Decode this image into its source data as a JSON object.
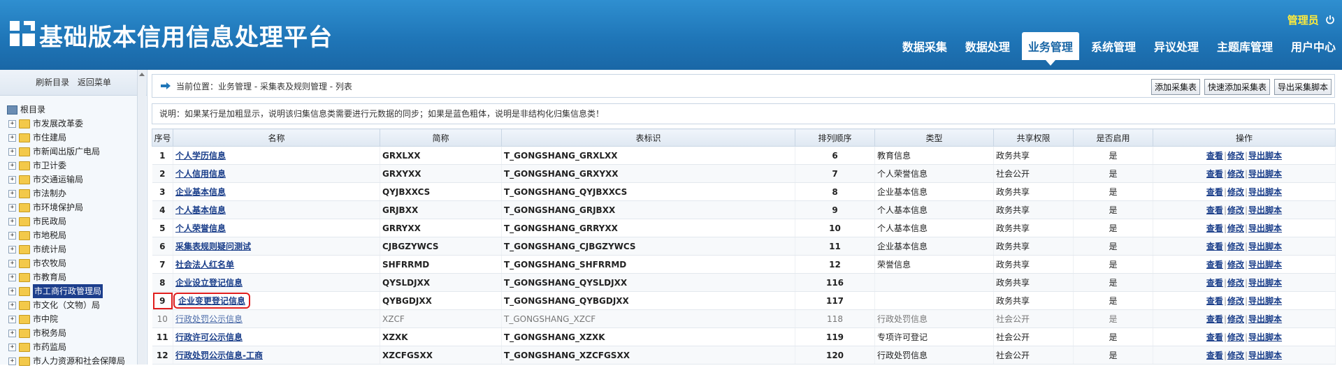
{
  "header": {
    "title": "基础版本信用信息处理平台",
    "user": "管理员",
    "nav": [
      "数据采集",
      "数据处理",
      "业务管理",
      "系统管理",
      "异议处理",
      "主题库管理",
      "用户中心"
    ],
    "active_nav": "业务管理"
  },
  "sidebar": {
    "refresh": "刷新目录",
    "back": "返回菜单",
    "root": "根目录",
    "items": [
      "市发展改革委",
      "市住建局",
      "市新闻出版广电局",
      "市卫计委",
      "市交通运输局",
      "市法制办",
      "市环境保护局",
      "市民政局",
      "市地税局",
      "市统计局",
      "市农牧局",
      "市教育局",
      "市工商行政管理局",
      "市文化（文物）局",
      "市中院",
      "市税务局",
      "市药监局",
      "市人力资源和社会保障局"
    ],
    "selected": "市工商行政管理局"
  },
  "location": {
    "label": "当前位置：",
    "path": "业务管理 - 采集表及规则管理 - 列表"
  },
  "buttons": [
    "添加采集表",
    "快速添加采集表",
    "导出采集脚本"
  ],
  "note": "说明：如果某行是加粗显示，说明该归集信息类需要进行元数据的同步；如果是蓝色粗体，说明是非结构化归集信息类！",
  "table": {
    "headers": [
      "序号",
      "名称",
      "简称",
      "表标识",
      "排列顺序",
      "类型",
      "共享权限",
      "是否启用",
      "操作"
    ],
    "ops": [
      "查看",
      "修改",
      "导出脚本"
    ],
    "rows": [
      {
        "no": "1",
        "name": "个人学历信息",
        "short": "GRXLXX",
        "table": "T_GONGSHANG_GRXLXX",
        "order": "6",
        "type": "教育信息",
        "share": "政务共享",
        "enabled": "是",
        "bold": true
      },
      {
        "no": "2",
        "name": "个人信用信息",
        "short": "GRXYXX",
        "table": "T_GONGSHANG_GRXYXX",
        "order": "7",
        "type": "个人荣誉信息",
        "share": "社会公开",
        "enabled": "是",
        "bold": true
      },
      {
        "no": "3",
        "name": "企业基本信息",
        "short": "QYJBXXCS",
        "table": "T_GONGSHANG_QYJBXXCS",
        "order": "8",
        "type": "企业基本信息",
        "share": "政务共享",
        "enabled": "是",
        "bold": true
      },
      {
        "no": "4",
        "name": "个人基本信息",
        "short": "GRJBXX",
        "table": "T_GONGSHANG_GRJBXX",
        "order": "9",
        "type": "个人基本信息",
        "share": "政务共享",
        "enabled": "是",
        "bold": true
      },
      {
        "no": "5",
        "name": "个人荣誉信息",
        "short": "GRRYXX",
        "table": "T_GONGSHANG_GRRYXX",
        "order": "10",
        "type": "个人基本信息",
        "share": "政务共享",
        "enabled": "是",
        "bold": true
      },
      {
        "no": "6",
        "name": "采集表规则疑问测试",
        "short": "CJBGZYWCS",
        "table": "T_GONGSHANG_CJBGZYWCS",
        "order": "11",
        "type": "企业基本信息",
        "share": "政务共享",
        "enabled": "是",
        "bold": true
      },
      {
        "no": "7",
        "name": "社会法人红名单",
        "short": "SHFRRMD",
        "table": "T_GONGSHANG_SHFRRMD",
        "order": "12",
        "type": "荣誉信息",
        "share": "政务共享",
        "enabled": "是",
        "bold": true
      },
      {
        "no": "8",
        "name": "企业设立登记信息",
        "short": "QYSLDJXX",
        "table": "T_GONGSHANG_QYSLDJXX",
        "order": "116",
        "type": "",
        "share": "政务共享",
        "enabled": "是",
        "bold": true
      },
      {
        "no": "9",
        "name": "企业变更登记信息",
        "short": "QYBGDJXX",
        "table": "T_GONGSHANG_QYBGDJXX",
        "order": "117",
        "type": "",
        "share": "政务共享",
        "enabled": "是",
        "bold": true,
        "highlight": true
      },
      {
        "no": "10",
        "name": "行政处罚公示信息",
        "short": "XZCF",
        "table": "T_GONGSHANG_XZCF",
        "order": "118",
        "type": "行政处罚信息",
        "share": "社会公开",
        "enabled": "是",
        "bold": false
      },
      {
        "no": "11",
        "name": "行政许可公示信息",
        "short": "XZXK",
        "table": "T_GONGSHANG_XZXK",
        "order": "119",
        "type": "专项许可登记",
        "share": "社会公开",
        "enabled": "是",
        "bold": true
      },
      {
        "no": "12",
        "name": "行政处罚公示信息-工商",
        "short": "XZCFGSXX",
        "table": "T_GONGSHANG_XZCFGSXX",
        "order": "120",
        "type": "行政处罚信息",
        "share": "社会公开",
        "enabled": "是",
        "bold": true
      }
    ]
  }
}
